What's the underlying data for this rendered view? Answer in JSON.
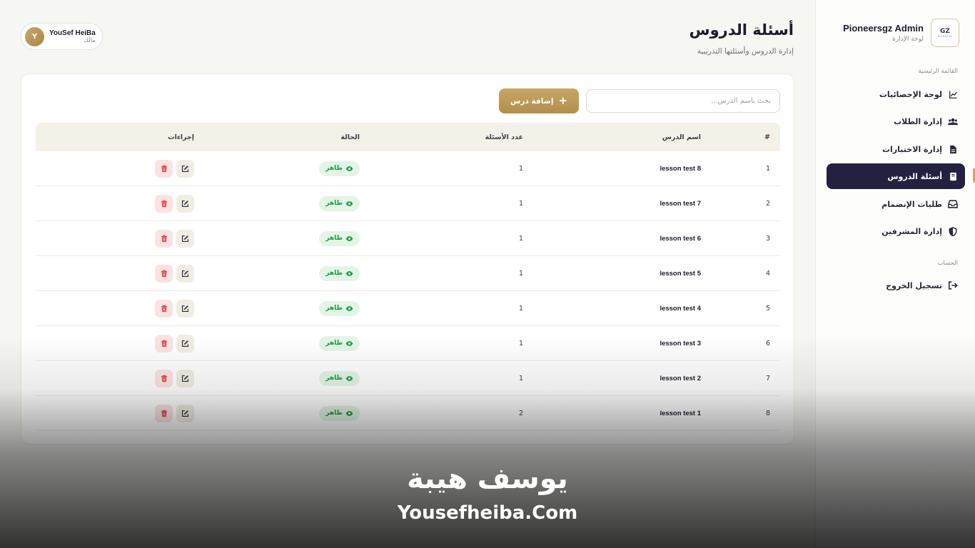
{
  "sidebar": {
    "brand_name": "Pioneersgz Admin",
    "brand_sub": "لوحة الإدارة",
    "logo_text": "GZ",
    "logo_sub": "PIONEERS",
    "main_section": "القائمة الرئيسية",
    "account_section": "الحساب",
    "items": [
      {
        "label": "لوحة الإحصائيات",
        "icon": "chart-line-icon"
      },
      {
        "label": "إدارة الطلاب",
        "icon": "users-icon"
      },
      {
        "label": "إدارة الاختبارات",
        "icon": "file-icon"
      },
      {
        "label": "أسئلة الدروس",
        "icon": "book-icon",
        "active": true
      },
      {
        "label": "طلبات الإنضمام",
        "icon": "inbox-icon"
      },
      {
        "label": "إدارة المشرفين",
        "icon": "shield-icon"
      }
    ],
    "logout": "تسجيل الخروج"
  },
  "header": {
    "title": "أسئلة الدروس",
    "subtitle": "إدارة الدروس وأسئلتها التدريبية"
  },
  "user": {
    "initial": "Y",
    "name": "YouSef HeiBa",
    "role": "مالك"
  },
  "toolbar": {
    "search_placeholder": "بحث باسم الدرس...",
    "add_label": "إضافة درس"
  },
  "table": {
    "headers": {
      "num": "#",
      "name": "اسم الدرس",
      "count": "عدد الأسئلة",
      "status": "الحالة",
      "actions": "إجراءات"
    },
    "rows": [
      {
        "num": "1",
        "name": "lesson test 8",
        "count": "1",
        "status": "ظاهر"
      },
      {
        "num": "2",
        "name": "lesson test 7",
        "count": "1",
        "status": "ظاهر"
      },
      {
        "num": "3",
        "name": "lesson test 6",
        "count": "1",
        "status": "ظاهر"
      },
      {
        "num": "4",
        "name": "lesson test 5",
        "count": "1",
        "status": "ظاهر"
      },
      {
        "num": "5",
        "name": "lesson test 4",
        "count": "1",
        "status": "ظاهر"
      },
      {
        "num": "6",
        "name": "lesson test 3",
        "count": "1",
        "status": "ظاهر"
      },
      {
        "num": "7",
        "name": "lesson test 2",
        "count": "1",
        "status": "ظاهر"
      },
      {
        "num": "8",
        "name": "lesson test 1",
        "count": "2",
        "status": "ظاهر"
      }
    ]
  },
  "watermark": {
    "arabic": "يوسف هيبة",
    "english": "Yousefheiba.Com"
  },
  "colors": {
    "accent": "#c6a765",
    "active_nav": "#23213f",
    "status_green": "#1f9a47",
    "delete_red": "#e04848"
  }
}
